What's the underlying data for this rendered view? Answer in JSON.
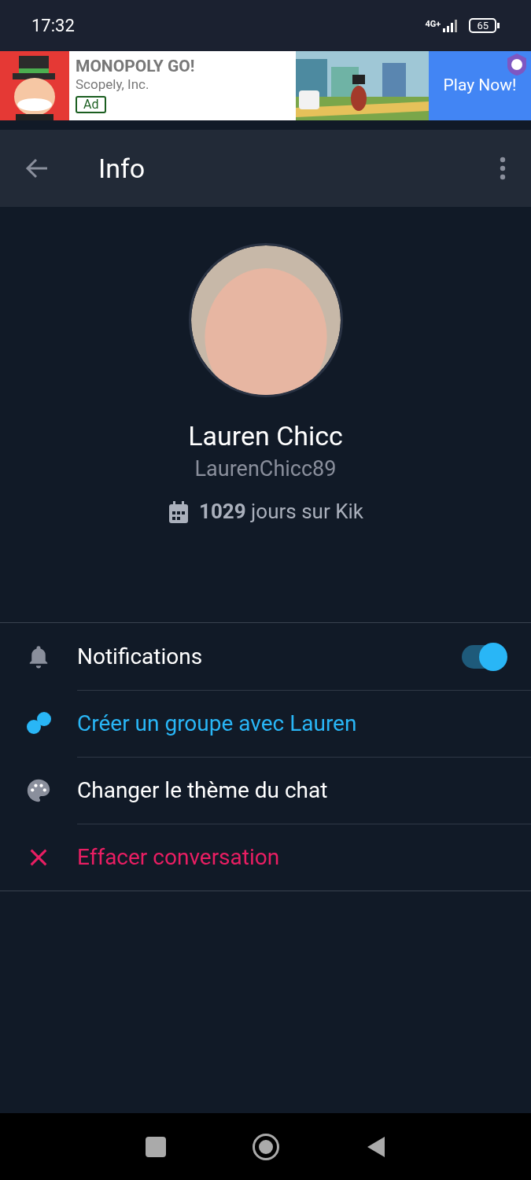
{
  "status_bar": {
    "time": "17:32",
    "network": "4G+",
    "battery": "65"
  },
  "ad": {
    "title": "MONOPOLY GO!",
    "publisher": "Scopely, Inc.",
    "badge": "Ad",
    "cta": "Play Now!"
  },
  "toolbar": {
    "title": "Info"
  },
  "profile": {
    "name": "Lauren Chicc",
    "username": "LaurenChicc89",
    "days": "**1029** jours sur Kik"
  },
  "rows": [
    {
      "kind": "toggle",
      "label": "Notifications",
      "on": true
    },
    {
      "kind": "group",
      "label": "Créer un groupe avec Lauren"
    },
    {
      "kind": "theme",
      "label": "Changer le thème du chat"
    },
    {
      "kind": "delete",
      "label": "Effacer conversation"
    }
  ]
}
